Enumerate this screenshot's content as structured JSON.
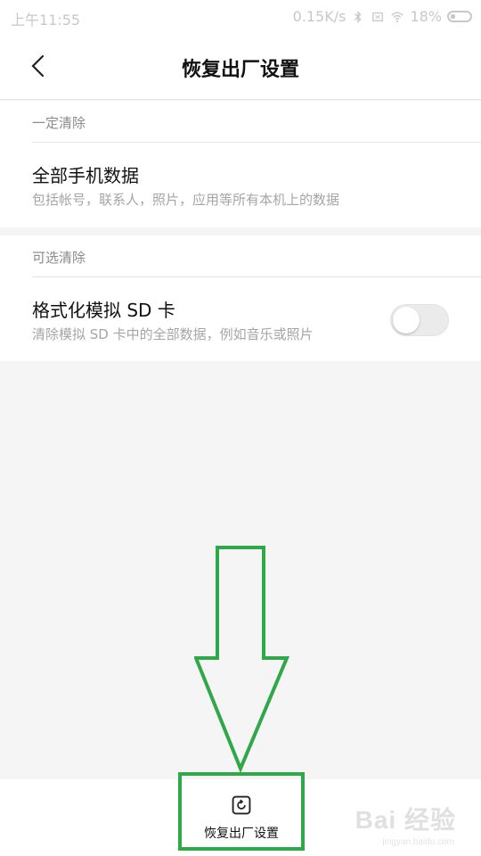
{
  "status_bar": {
    "time": "上午11:55",
    "speed": "0.15K/s",
    "battery": "18%",
    "icons": [
      "bluetooth-icon",
      "sim-icon",
      "wifi-icon",
      "battery-icon"
    ]
  },
  "header": {
    "title": "恢复出厂设置",
    "back_icon": "back-arrow-icon"
  },
  "sections": [
    {
      "label": "一定清除",
      "item": {
        "title": "全部手机数据",
        "subtitle": "包括帐号，联系人，照片，应用等所有本机上的数据"
      }
    },
    {
      "label": "可选清除",
      "item": {
        "title": "格式化模拟 SD 卡",
        "subtitle": "清除模拟 SD 卡中的全部数据，例如音乐或照片",
        "toggle_on": false
      }
    }
  ],
  "bottom": {
    "reset_label": "恢复出厂设置",
    "reset_icon": "reset-icon"
  },
  "annotation": {
    "arrow_color": "#2fa84a",
    "highlight_color": "#2fa84a"
  },
  "watermark": {
    "text": "Bai 经验",
    "sub": "jingyan.baidu.com"
  }
}
